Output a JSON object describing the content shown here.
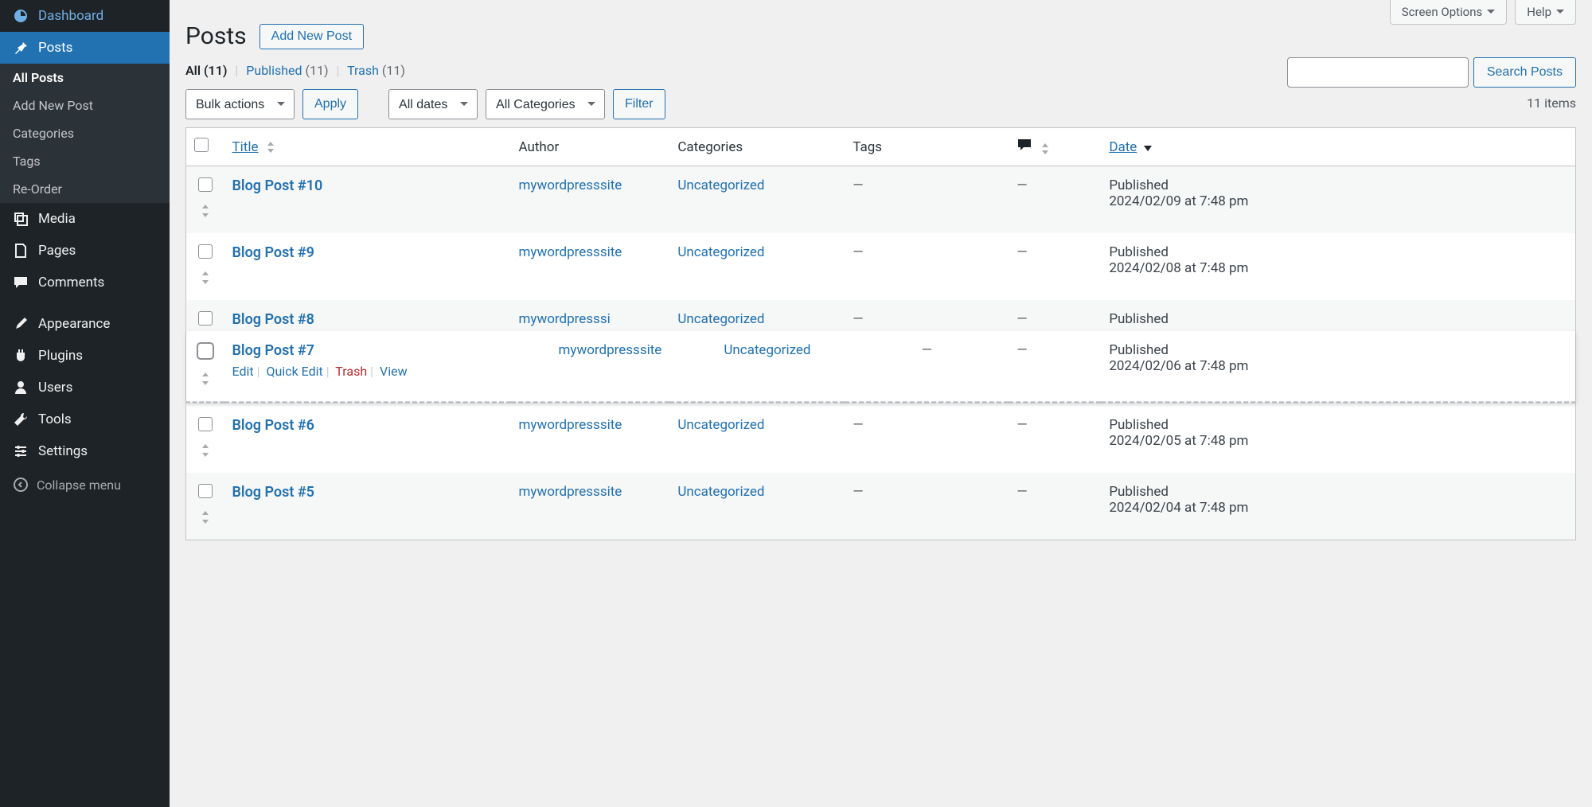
{
  "top_tabs": {
    "screen_options": "Screen Options",
    "help": "Help"
  },
  "sidebar": {
    "dashboard": "Dashboard",
    "posts": "Posts",
    "media": "Media",
    "pages": "Pages",
    "comments": "Comments",
    "appearance": "Appearance",
    "plugins": "Plugins",
    "users": "Users",
    "tools": "Tools",
    "settings": "Settings",
    "collapse": "Collapse menu",
    "sub": {
      "all_posts": "All Posts",
      "add_new": "Add New Post",
      "categories": "Categories",
      "tags": "Tags",
      "reorder": "Re-Order"
    }
  },
  "heading": {
    "title": "Posts",
    "add_new": "Add New Post"
  },
  "filters": {
    "all_label": "All",
    "all_count": "(11)",
    "published_label": "Published",
    "published_count": "(11)",
    "trash_label": "Trash",
    "trash_count": "(11)"
  },
  "search": {
    "button": "Search Posts"
  },
  "bulk": {
    "bulk_actions": "Bulk actions",
    "apply": "Apply",
    "all_dates": "All dates",
    "all_categories": "All Categories",
    "filter": "Filter",
    "item_count": "11 items"
  },
  "columns": {
    "title": "Title",
    "author": "Author",
    "categories": "Categories",
    "tags": "Tags",
    "date": "Date"
  },
  "row_actions": {
    "edit": "Edit",
    "quick_edit": "Quick Edit",
    "trash": "Trash",
    "view": "View"
  },
  "rows": [
    {
      "title": "Blog Post #10",
      "author": "mywordpresssite",
      "author_display": "mywordpresssite",
      "category": "Uncategorized",
      "tags": "—",
      "comments": "—",
      "status": "Published",
      "date": "2024/02/09 at 7:48 pm"
    },
    {
      "title": "Blog Post #9",
      "author": "mywordpresssite",
      "author_display": "mywordpresssite",
      "category": "Uncategorized",
      "tags": "—",
      "comments": "—",
      "status": "Published",
      "date": "2024/02/08 at 7:48 pm"
    },
    {
      "title": "Blog Post #8",
      "author": "mywordpresssi",
      "author_display": "mywordpresssi",
      "category": "Uncategorized",
      "tags": "—",
      "comments": "—",
      "status": "Published",
      "date": ""
    },
    {
      "title": "Blog Post #7",
      "author": "mywordpresssite",
      "author_display": "mywordpresssite",
      "category": "Uncategorized",
      "tags": "—",
      "comments": "—",
      "status": "Published",
      "date": "2024/02/06 at 7:48 pm"
    },
    {
      "title": "Blog Post #6",
      "author": "mywordpresssite",
      "author_display": "mywordpresssite",
      "category": "Uncategorized",
      "tags": "—",
      "comments": "—",
      "status": "Published",
      "date": "2024/02/05 at 7:48 pm"
    },
    {
      "title": "Blog Post #5",
      "author": "mywordpresssite",
      "author_display": "mywordpresssite",
      "category": "Uncategorized",
      "tags": "—",
      "comments": "—",
      "status": "Published",
      "date": "2024/02/04 at 7:48 pm"
    }
  ]
}
